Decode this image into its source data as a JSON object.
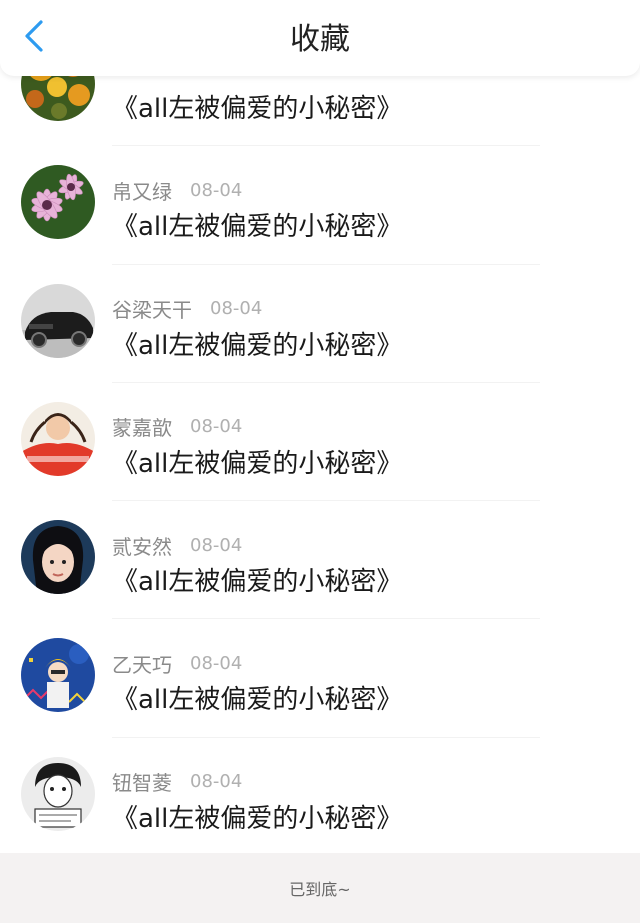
{
  "header": {
    "title": "收藏",
    "back_icon": "chevron-left-icon",
    "accent_color": "#2d9bf0"
  },
  "favorites": [
    {
      "author": "",
      "date": "",
      "title": "《all左被偏爱的小秘密》",
      "avatar": "flowers-avatar"
    },
    {
      "author": "帛又绿",
      "date": "08-04",
      "title": "《all左被偏爱的小秘密》",
      "avatar": "daisy-avatar"
    },
    {
      "author": "谷梁天干",
      "date": "08-04",
      "title": "《all左被偏爱的小秘密》",
      "avatar": "car-avatar"
    },
    {
      "author": "蒙嘉歆",
      "date": "08-04",
      "title": "《all左被偏爱的小秘密》",
      "avatar": "girl-red-avatar"
    },
    {
      "author": "贰安然",
      "date": "08-04",
      "title": "《all左被偏爱的小秘密》",
      "avatar": "portrait-avatar"
    },
    {
      "author": "乙天巧",
      "date": "08-04",
      "title": "《all左被偏爱的小秘密》",
      "avatar": "monday-cartoon-avatar"
    },
    {
      "author": "钮智菱",
      "date": "08-04",
      "title": "《all左被偏爱的小秘密》",
      "avatar": "sketch-avatar"
    }
  ],
  "footer": {
    "end_text": "已到底~"
  }
}
